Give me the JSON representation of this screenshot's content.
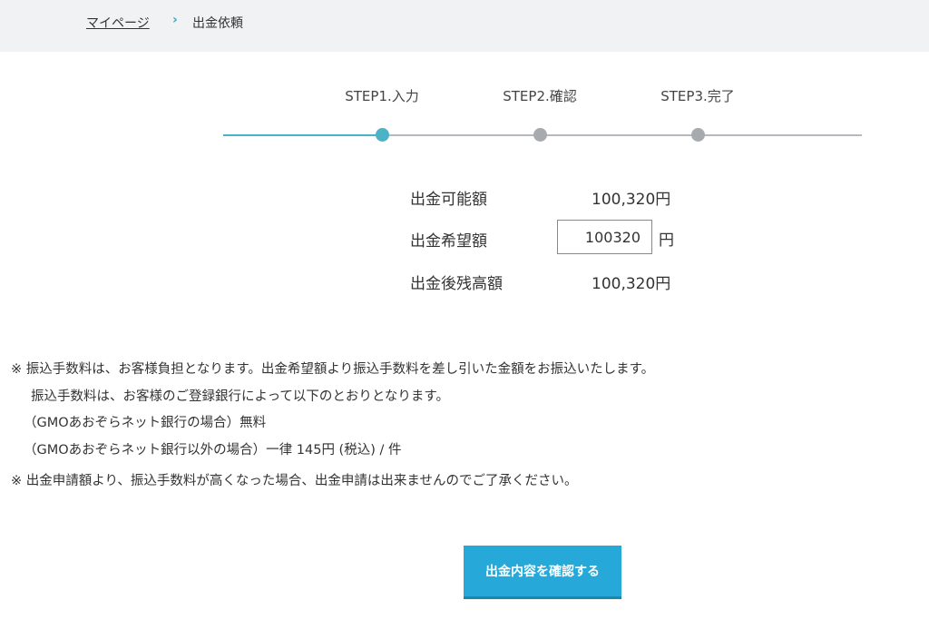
{
  "breadcrumb": {
    "home": "マイページ",
    "separator": "›",
    "current": "出金依頼"
  },
  "steps": [
    {
      "label": "STEP1.入力",
      "active": true
    },
    {
      "label": "STEP2.確認",
      "active": false
    },
    {
      "label": "STEP3.完了",
      "active": false
    }
  ],
  "form": {
    "available_label": "出金可能額",
    "available_value": "100,320円",
    "request_label": "出金希望額",
    "request_value": "100320",
    "request_unit": "円",
    "remaining_label": "出金後残高額",
    "remaining_value": "100,320円"
  },
  "notes": {
    "line1": "※ 振込手数料は、お客様負担となります。出金希望額より振込手数料を差し引いた金額をお振込いたします。",
    "line2": "振込手数料は、お客様のご登録銀行によって以下のとおりとなります。",
    "line3": "（GMOあおぞらネット銀行の場合）無料",
    "line4": "（GMOあおぞらネット銀行以外の場合）一律 145円 (税込) / 件",
    "line5": "※ 出金申請額より、振込手数料が高くなった場合、出金申請は出来ませんのでご了承ください。"
  },
  "confirm_button_label": "出金内容を確認する",
  "colors": {
    "accent": "#4ab3c7",
    "button": "#26a9d8",
    "inactive_step": "#a7abaf"
  }
}
